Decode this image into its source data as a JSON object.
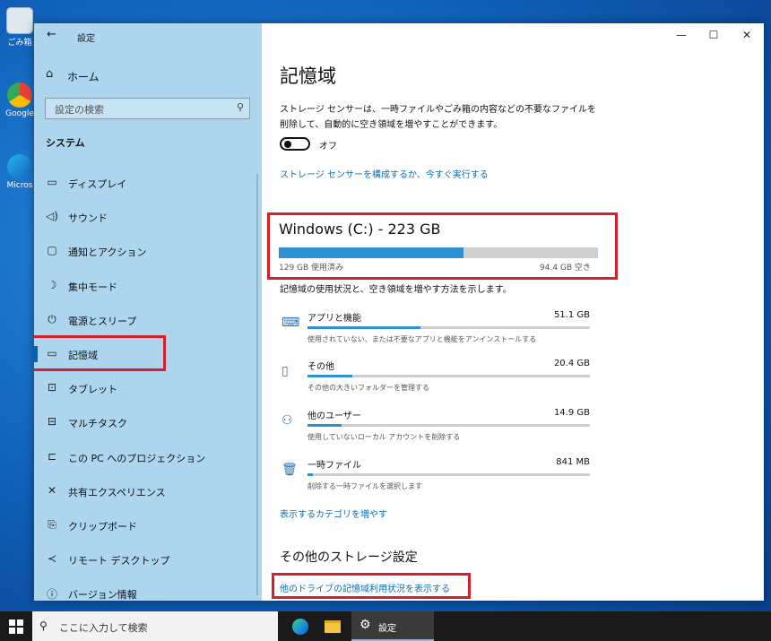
{
  "desktop": {
    "icons": [
      {
        "label": "ごみ箱",
        "icon": "recycle-bin-icon"
      },
      {
        "label": "Google",
        "icon": "chrome-icon"
      },
      {
        "label": "Micros",
        "icon": "edge-icon"
      }
    ]
  },
  "window": {
    "title": "設定",
    "controls": {
      "minimize": "—",
      "maximize": "☐",
      "close": "✕"
    }
  },
  "sidebar": {
    "home_label": "ホーム",
    "search_placeholder": "設定の検索",
    "section_header": "システム",
    "items": [
      {
        "label": "ディスプレイ",
        "icon": "display-icon",
        "glyph": "▭"
      },
      {
        "label": "サウンド",
        "icon": "sound-icon",
        "glyph": "◁)"
      },
      {
        "label": "通知とアクション",
        "icon": "notification-icon",
        "glyph": "▢"
      },
      {
        "label": "集中モード",
        "icon": "moon-icon",
        "glyph": "☽"
      },
      {
        "label": "電源とスリープ",
        "icon": "power-icon",
        "glyph": "⏻"
      },
      {
        "label": "記憶域",
        "icon": "storage-icon",
        "glyph": "▭",
        "selected": true
      },
      {
        "label": "タブレット",
        "icon": "tablet-icon",
        "glyph": "⊡"
      },
      {
        "label": "マルチタスク",
        "icon": "multitask-icon",
        "glyph": "⊟"
      },
      {
        "label": "この PC へのプロジェクション",
        "icon": "projection-icon",
        "glyph": "⊏"
      },
      {
        "label": "共有エクスペリエンス",
        "icon": "shared-experience-icon",
        "glyph": "✕"
      },
      {
        "label": "クリップボード",
        "icon": "clipboard-icon",
        "glyph": "⎘"
      },
      {
        "label": "リモート デスクトップ",
        "icon": "remote-desktop-icon",
        "glyph": "≺"
      },
      {
        "label": "バージョン情報",
        "icon": "info-icon",
        "glyph": "ⓘ"
      }
    ]
  },
  "main": {
    "title": "記憶域",
    "description": "ストレージ センサーは、一時ファイルやごみ箱の内容などの不要なファイルを削除して、自動的に空き領域を増やすことができます。",
    "storage_sense_state": "オフ",
    "storage_sense_link": "ストレージ センサーを構成するか、今すぐ実行する",
    "drive": {
      "title": "Windows (C:) - 223 GB",
      "used": "129 GB 使用済み",
      "free": "94.4 GB 空き",
      "used_fraction": 0.58
    },
    "usage_note": "記憶域の使用状況と、空き領域を増やす方法を示します。",
    "categories": [
      {
        "name": "アプリと機能",
        "size": "51.1 GB",
        "desc": "使用されていない、または不要なアプリと機能をアンインストールする",
        "icon": "apps-icon",
        "glyph": "⌨",
        "fraction": 0.4
      },
      {
        "name": "その他",
        "size": "20.4 GB",
        "desc": "その他の大きいフォルダーを管理する",
        "icon": "folder-icon",
        "glyph": "▯",
        "fraction": 0.16
      },
      {
        "name": "他のユーザー",
        "size": "14.9 GB",
        "desc": "使用していないローカル アカウントを削除する",
        "icon": "users-icon",
        "glyph": "⚇",
        "fraction": 0.12
      },
      {
        "name": "一時ファイル",
        "size": "841 MB",
        "desc": "削除する一時ファイルを選択します",
        "icon": "trash-icon",
        "glyph": "🗑",
        "fraction": 0.02
      }
    ],
    "show_more_link": "表示するカテゴリを増やす",
    "other_heading": "その他のストレージ設定",
    "other_drives_link": "他のドライブの記憶域利用状況を表示する"
  },
  "taskbar": {
    "search_placeholder": "ここに入力して検索",
    "settings_label": "設定"
  },
  "colors": {
    "accent": "#0063b1",
    "bar_fill": "#2e8fd1",
    "highlight_red": "#d4202a",
    "sidebar_bg": "#add6ee"
  }
}
